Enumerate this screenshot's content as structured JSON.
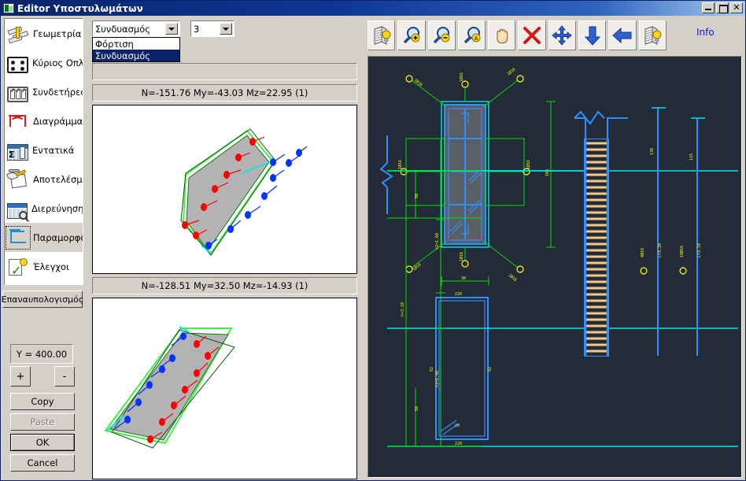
{
  "window": {
    "title": "Editor Υποστυλωμάτων",
    "icon": "app-icon",
    "minimize_label": "_",
    "maximize_label": "□",
    "close_label": "✕"
  },
  "sidebar": {
    "items": [
      {
        "label": "Γεωμετρία",
        "icon": "geometry-icon",
        "selected": false
      },
      {
        "label": "Κύριος Οπλισμός",
        "icon": "main-rebar-icon",
        "selected": false
      },
      {
        "label": "Συνδετήρες",
        "icon": "stirrups-icon",
        "selected": false
      },
      {
        "label": "Διαγράμματα",
        "icon": "diagrams-icon",
        "selected": false
      },
      {
        "label": "Εντατικά",
        "icon": "forces-icon",
        "selected": false
      },
      {
        "label": "Αποτελέσματα",
        "icon": "results-icon",
        "selected": false
      },
      {
        "label": "Διερεύνηση",
        "icon": "investigation-icon",
        "selected": false
      },
      {
        "label": "Παραμορφώσεις",
        "icon": "deformations-icon",
        "selected": true
      },
      {
        "label": "Έλεγχοι",
        "icon": "checks-icon",
        "selected": false
      }
    ]
  },
  "left_controls": {
    "recalc_label": "Επαναυπολογισμός",
    "y_value": "Y = 400.00",
    "plus_label": "+",
    "minus_label": "-",
    "copy_label": "Copy",
    "paste_label": "Paste",
    "paste_disabled": true,
    "ok_label": "OK",
    "cancel_label": "Cancel"
  },
  "middle": {
    "combo_type": {
      "value": "Συνδυασμός",
      "options": [
        "Φόρτιση",
        "Συνδυασμός"
      ],
      "selected_option": "Συνδυασμός",
      "expanded": true
    },
    "combo_number": {
      "value": "3"
    },
    "label_1": "N=-151.76 My=-43.03 Mz=22.95 (1)",
    "label_2": "N=-128.51 My=32.50 Mz=-14.93 (1)"
  },
  "toolbar": {
    "buttons": [
      {
        "name": "layers-lightbulb-icon",
        "title": "3D View"
      },
      {
        "name": "zoom-in-icon",
        "title": "Zoom In"
      },
      {
        "name": "zoom-out-icon",
        "title": "Zoom Out"
      },
      {
        "name": "zoom-all-icon",
        "title": "Zoom All"
      },
      {
        "name": "pan-hand-icon",
        "title": "Pan"
      },
      {
        "name": "delete-x-icon",
        "title": "Delete"
      },
      {
        "name": "move-arrows-icon",
        "title": "Move"
      },
      {
        "name": "arrow-down-icon",
        "title": "Down"
      },
      {
        "name": "arrow-left-icon",
        "title": "Left"
      },
      {
        "name": "layers-lightbulb-2-icon",
        "title": "Render"
      }
    ],
    "info_label": "Info"
  },
  "cad": {
    "background": "#232b38",
    "section_top": {
      "rebar_labels": [
        "1Ø16",
        "1Ø16",
        "1Ø16",
        "1Ø16",
        "1Ø16",
        "1Ø16",
        "1Ø16",
        "1Ø16"
      ],
      "dim_height": "100",
      "dim_width": "30"
    },
    "stirrup_detail": {
      "top_dim": "220",
      "left_dim": "92",
      "right_dim": "92",
      "hook_dim": "10",
      "bottom_dim": "220"
    },
    "elevation": {
      "height_labels": [
        "h=3.10",
        "h2=1.60",
        "h1=1.90"
      ],
      "offset_labels": [
        "50",
        "50"
      ],
      "bar_labels": [
        "4Ø16",
        "L=3.20",
        "10Ø16",
        "L=3.10"
      ],
      "top_labels": [
        "130",
        "115"
      ]
    }
  },
  "colors": {
    "titlebar_start": "#0a246a",
    "titlebar_end": "#a6caf0",
    "face": "#d4d0c8",
    "cad_bg": "#232b38",
    "cad_green": "#00e000",
    "cad_cyan": "#00e6e6",
    "cad_blue": "#2f8fff",
    "cad_yellow": "#ffff00",
    "cad_orange": "#f5c98a",
    "info_blue": "#1a1ad0",
    "rebar_red": "#ff0000",
    "rebar_blue": "#0033ff",
    "section_fill": "#b0b0b0",
    "section_outline": "#00d000"
  }
}
